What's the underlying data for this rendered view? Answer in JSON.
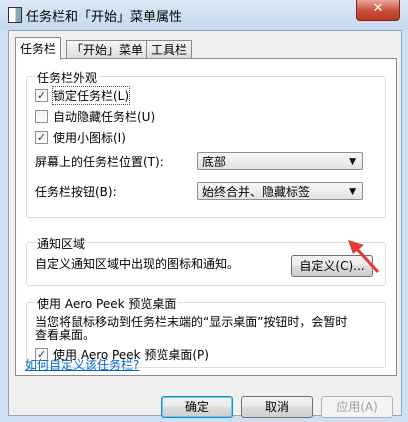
{
  "window": {
    "title": "任务栏和「开始」菜单属性",
    "close_glyph": "✕"
  },
  "tabs": [
    {
      "label": "任务栏",
      "active": true
    },
    {
      "label": "「开始」菜单",
      "active": false
    },
    {
      "label": "工具栏",
      "active": false
    }
  ],
  "appearance": {
    "group_title": "任务栏外观",
    "lock_taskbar": {
      "label": "锁定任务栏(L)",
      "checked": true
    },
    "autohide": {
      "label": "自动隐藏任务栏(U)",
      "checked": false
    },
    "small_icons": {
      "label": "使用小图标(I)",
      "checked": true
    },
    "location_label": "屏幕上的任务栏位置(T):",
    "location_value": "底部",
    "buttons_label": "任务栏按钮(B):",
    "buttons_value": "始终合并、隐藏标签"
  },
  "notification": {
    "group_title": "通知区域",
    "description": "自定义通知区域中出现的图标和通知。",
    "customize_label": "自定义(C)..."
  },
  "peek": {
    "group_title": "使用 Aero Peek 预览桌面",
    "description_line1": "当您将鼠标移动到任务栏末端的“显示桌面”按钮时，会暂时",
    "description_line2": "查看桌面。",
    "checkbox": {
      "label": "使用 Aero Peek 预览桌面(P)",
      "checked": true
    }
  },
  "help_link": "如何自定义该任务栏?",
  "footer": {
    "ok_label": "确定",
    "cancel_label": "取消",
    "apply_label": "应用(A)"
  },
  "colors": {
    "annotation_arrow": "#e53935",
    "link": "#0066cc"
  }
}
